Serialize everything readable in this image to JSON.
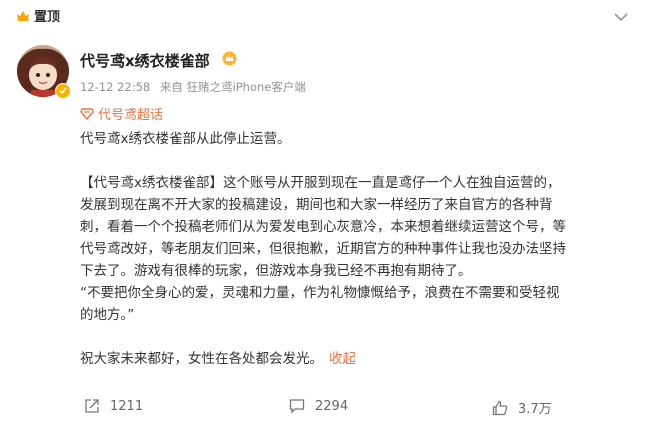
{
  "pin": {
    "label": "置顶"
  },
  "user": {
    "name": "代号鸢x绣衣楼雀部"
  },
  "meta": {
    "time": "12-12 22:58",
    "source": "来自 狂赌之鸢iPhone客户端"
  },
  "topic": {
    "label": "代号鸢超话"
  },
  "content": {
    "lines": [
      "代号鸢x绣衣楼雀部从此停止运营。",
      "",
      "【代号鸢x绣衣楼雀部】这个账号从开服到现在一直是鸢仔一个人在独自运营的，",
      "发展到现在离不开大家的投稿建设，期间也和大家一样经历了来自官方的各种背",
      "刺，看着一个个投稿老师们从为爱发电到心灰意冷，本来想着继续运营这个号，等",
      "代号鸢改好，等老朋友们回来，但很抱歉，近期官方的种种事件让我也没办法坚持",
      "下去了。游戏有很棒的玩家，但游戏本身我已经不再抱有期待了。",
      "“不要把你全身心的爱，灵魂和力量，作为礼物慷慨给予，浪费在不需要和受轻视",
      "的地方。”",
      "",
      "祝大家未来都好，女性在各处都会发光。"
    ],
    "collapse": "收起"
  },
  "actions": {
    "repost": "1211",
    "comment": "2294",
    "like": "3.7万"
  },
  "colors": {
    "accent": "#eb7340",
    "meta": "#939393",
    "pin": "#f7b500"
  },
  "icons": [
    "pin-icon",
    "more-icon",
    "avatar",
    "verified-badge-icon",
    "member-crown-icon",
    "topic-icon",
    "repost-icon",
    "comment-icon",
    "like-icon"
  ]
}
